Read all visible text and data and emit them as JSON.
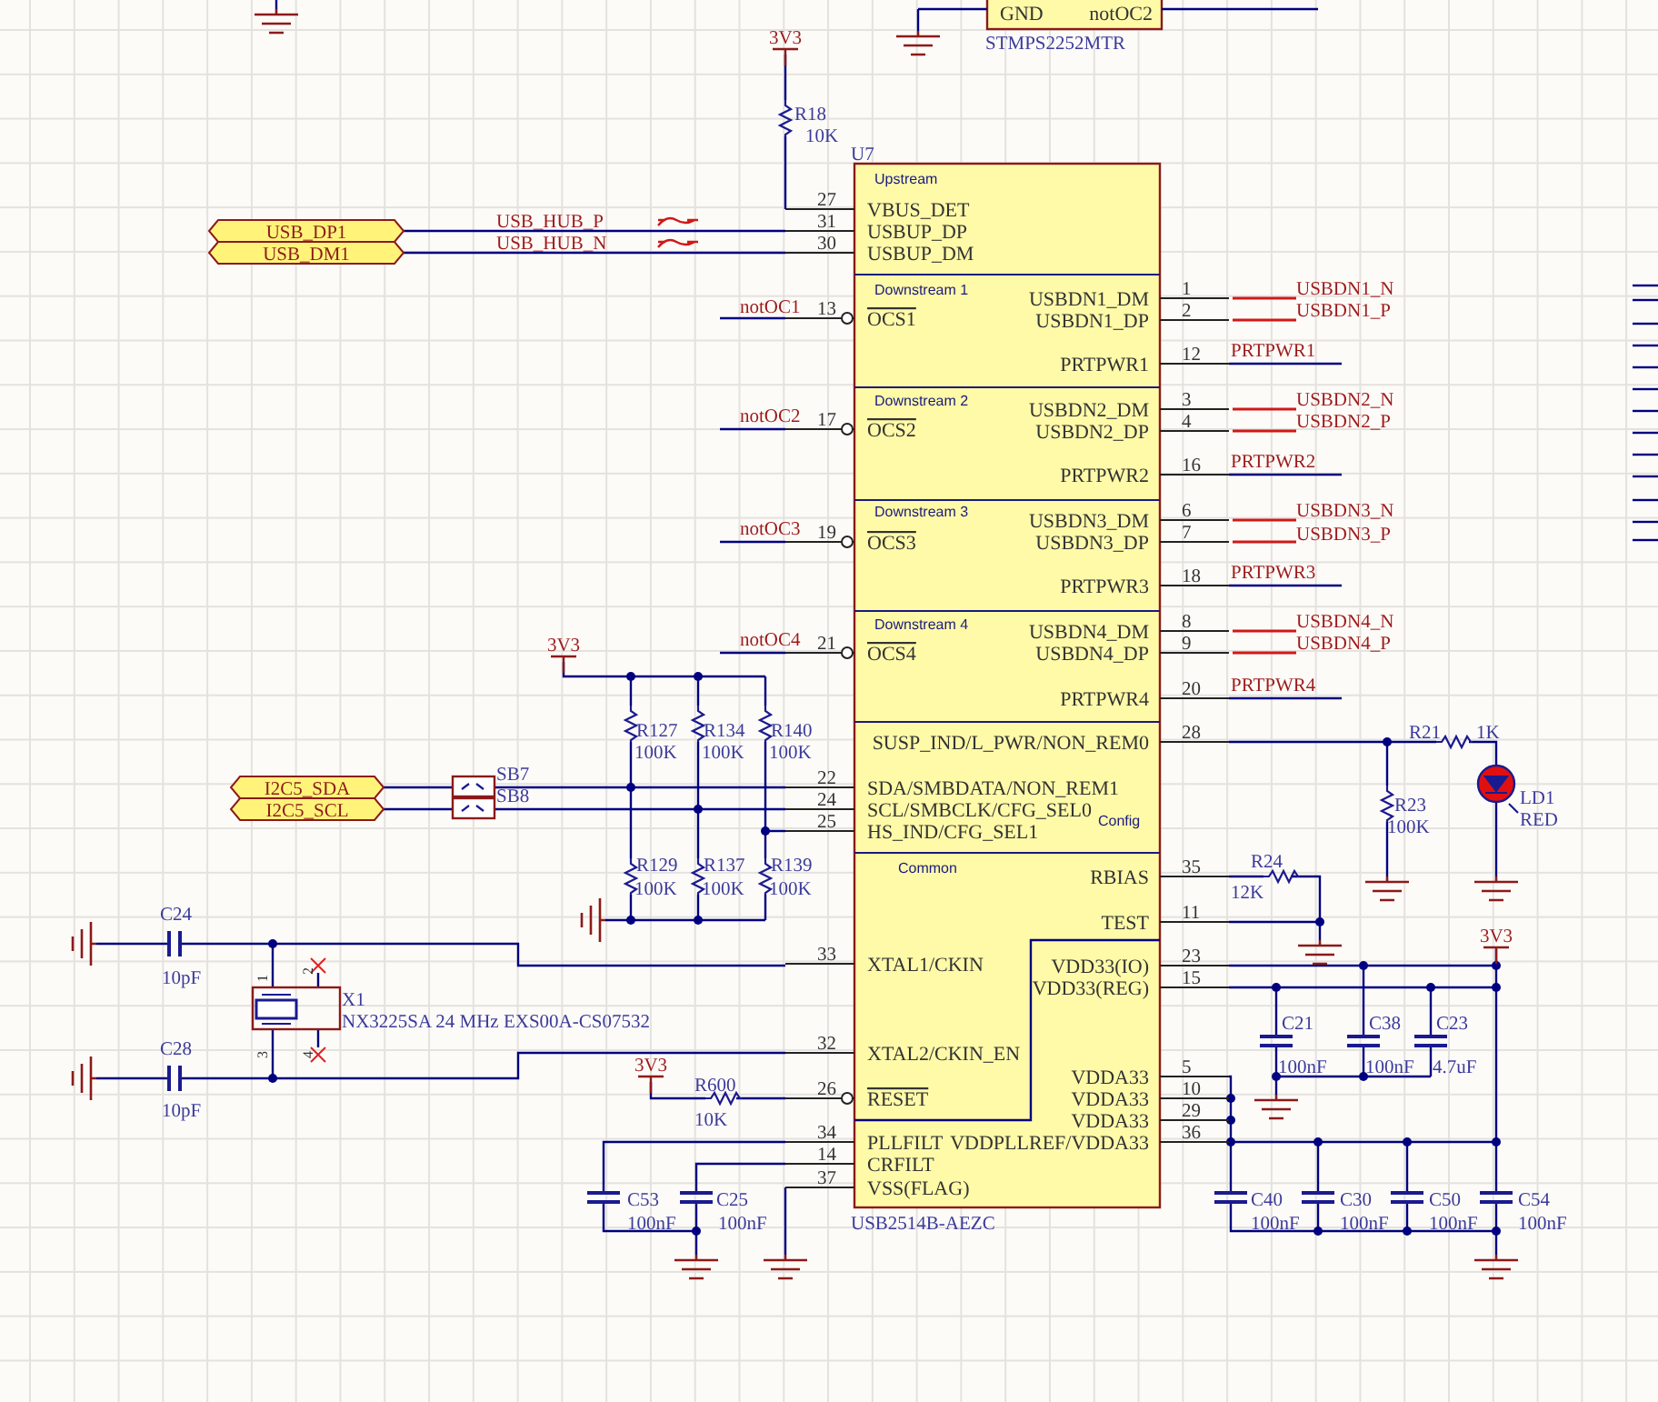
{
  "power_switch": {
    "part_number": "STMPS2252MTR",
    "pins": [
      {
        "name": "GND"
      },
      {
        "name": "notOC2"
      }
    ]
  },
  "hub": {
    "designator": "U7",
    "part_number": "USB2514B-AEZC",
    "sections": [
      {
        "title": "Upstream"
      },
      {
        "title": "Downstream 1"
      },
      {
        "title": "Downstream 2"
      },
      {
        "title": "Downstream 3"
      },
      {
        "title": "Downstream 4"
      },
      {
        "title": "Config"
      },
      {
        "title": "Common"
      }
    ],
    "pins": [
      {
        "name": "VBUS_DET",
        "number": "27",
        "active_low": false
      },
      {
        "name": "USBUP_DP",
        "number": "31",
        "active_low": false
      },
      {
        "name": "USBUP_DM",
        "number": "30",
        "active_low": false
      },
      {
        "name": "USBDN1_DM",
        "number": "1",
        "active_low": false
      },
      {
        "name": "OCS1",
        "number": "13",
        "active_low": true
      },
      {
        "name": "USBDN1_DP",
        "number": "2",
        "active_low": false
      },
      {
        "name": "PRTPWR1",
        "number": "12",
        "active_low": false
      },
      {
        "name": "USBDN2_DM",
        "number": "3",
        "active_low": false
      },
      {
        "name": "OCS2",
        "number": "17",
        "active_low": true
      },
      {
        "name": "USBDN2_DP",
        "number": "4",
        "active_low": false
      },
      {
        "name": "PRTPWR2",
        "number": "16",
        "active_low": false
      },
      {
        "name": "USBDN3_DM",
        "number": "6",
        "active_low": false
      },
      {
        "name": "OCS3",
        "number": "19",
        "active_low": true
      },
      {
        "name": "USBDN3_DP",
        "number": "7",
        "active_low": false
      },
      {
        "name": "PRTPWR3",
        "number": "18",
        "active_low": false
      },
      {
        "name": "USBDN4_DM",
        "number": "8",
        "active_low": false
      },
      {
        "name": "OCS4",
        "number": "21",
        "active_low": true
      },
      {
        "name": "USBDN4_DP",
        "number": "9",
        "active_low": false
      },
      {
        "name": "PRTPWR4",
        "number": "20",
        "active_low": false
      },
      {
        "name": "SUSP_IND/L_PWR/NON_REM0",
        "number": "28",
        "active_low": false
      },
      {
        "name": "SDA/SMBDATA/NON_REM1",
        "number": "22",
        "active_low": false
      },
      {
        "name": "SCL/SMBCLK/CFG_SEL0",
        "number": "24",
        "active_low": false
      },
      {
        "name": "HS_IND/CFG_SEL1",
        "number": "25",
        "active_low": false
      },
      {
        "name": "RBIAS",
        "number": "35",
        "active_low": false
      },
      {
        "name": "TEST",
        "number": "11",
        "active_low": false
      },
      {
        "name": "XTAL1/CKIN",
        "number": "33",
        "active_low": false
      },
      {
        "name": "VDD33(IO)",
        "number": "23",
        "active_low": false
      },
      {
        "name": "VDD33(REG)",
        "number": "15",
        "active_low": false
      },
      {
        "name": "XTAL2/CKIN_EN",
        "number": "32",
        "active_low": false
      },
      {
        "name": "VDDA33",
        "number": "5",
        "active_low": false
      },
      {
        "name": "RESET",
        "number": "26",
        "active_low": true
      },
      {
        "name": "VDDA33",
        "number": "10",
        "active_low": false
      },
      {
        "name": "VDDA33",
        "number": "29",
        "active_low": false
      },
      {
        "name": "PLLFILT",
        "number": "34",
        "active_low": false
      },
      {
        "name": "VDDPLLREF/VDDA33",
        "number": "36",
        "active_low": false
      },
      {
        "name": "CRFILT",
        "number": "14",
        "active_low": false
      },
      {
        "name": "VSS(FLAG)",
        "number": "37",
        "active_low": false
      }
    ]
  },
  "nets": [
    {
      "kind": "power",
      "name": "3V3"
    },
    {
      "kind": "net",
      "name": "USB_HUB_P"
    },
    {
      "kind": "net",
      "name": "USB_HUB_N"
    },
    {
      "kind": "port",
      "name": "USB_DP1"
    },
    {
      "kind": "port",
      "name": "USB_DM1"
    },
    {
      "kind": "net",
      "name": "notOC1"
    },
    {
      "kind": "net",
      "name": "USBDN1_N"
    },
    {
      "kind": "net",
      "name": "USBDN1_P"
    },
    {
      "kind": "net",
      "name": "PRTPWR1"
    },
    {
      "kind": "net",
      "name": "notOC2"
    },
    {
      "kind": "net",
      "name": "USBDN2_N"
    },
    {
      "kind": "net",
      "name": "USBDN2_P"
    },
    {
      "kind": "net",
      "name": "PRTPWR2"
    },
    {
      "kind": "net",
      "name": "notOC3"
    },
    {
      "kind": "net",
      "name": "USBDN3_N"
    },
    {
      "kind": "net",
      "name": "USBDN3_P"
    },
    {
      "kind": "net",
      "name": "PRTPWR3"
    },
    {
      "kind": "power",
      "name": "3V3"
    },
    {
      "kind": "net",
      "name": "notOC4"
    },
    {
      "kind": "net",
      "name": "USBDN4_N"
    },
    {
      "kind": "net",
      "name": "USBDN4_P"
    },
    {
      "kind": "net",
      "name": "PRTPWR4"
    },
    {
      "kind": "port",
      "name": "I2C5_SDA"
    },
    {
      "kind": "port",
      "name": "I2C5_SCL"
    },
    {
      "kind": "power",
      "name": "3V3"
    },
    {
      "kind": "power",
      "name": "3V3"
    }
  ],
  "components": [
    {
      "kind": "resistor",
      "designator": "R18",
      "value": "10K"
    },
    {
      "kind": "resistor",
      "designator": "R127",
      "value": "100K"
    },
    {
      "kind": "resistor",
      "designator": "R134",
      "value": "100K"
    },
    {
      "kind": "resistor",
      "designator": "R140",
      "value": "100K"
    },
    {
      "kind": "solder_bridge",
      "designator": "SB7"
    },
    {
      "kind": "solder_bridge",
      "designator": "SB8"
    },
    {
      "kind": "resistor",
      "designator": "R129",
      "value": "100K"
    },
    {
      "kind": "resistor",
      "designator": "R137",
      "value": "100K"
    },
    {
      "kind": "resistor",
      "designator": "R139",
      "value": "100K"
    },
    {
      "kind": "resistor",
      "designator": "R21",
      "value": "1K"
    },
    {
      "kind": "resistor",
      "designator": "R23",
      "value": "100K"
    },
    {
      "kind": "led",
      "designator": "LD1",
      "value": "RED"
    },
    {
      "kind": "resistor",
      "designator": "R24",
      "value": "12K"
    },
    {
      "kind": "capacitor",
      "designator": "C24",
      "value": "10pF"
    },
    {
      "kind": "crystal",
      "designator": "X1",
      "value": "NX3225SA 24 MHz EXS00A-CS07532",
      "pin_numbers": [
        "1",
        "2",
        "3",
        "4"
      ]
    },
    {
      "kind": "capacitor",
      "designator": "C28",
      "value": "10pF"
    },
    {
      "kind": "resistor",
      "designator": "R600",
      "value": "10K"
    },
    {
      "kind": "capacitor",
      "designator": "C21",
      "value": "100nF"
    },
    {
      "kind": "capacitor",
      "designator": "C38",
      "value": "100nF"
    },
    {
      "kind": "capacitor",
      "designator": "C23",
      "value": "4.7uF"
    },
    {
      "kind": "capacitor",
      "designator": "C53",
      "value": "100nF"
    },
    {
      "kind": "capacitor",
      "designator": "C25",
      "value": "100nF"
    },
    {
      "kind": "capacitor",
      "designator": "C40",
      "value": "100nF"
    },
    {
      "kind": "capacitor",
      "designator": "C30",
      "value": "100nF"
    },
    {
      "kind": "capacitor",
      "designator": "C50",
      "value": "100nF"
    },
    {
      "kind": "capacitor",
      "designator": "C54",
      "value": "100nF"
    }
  ]
}
